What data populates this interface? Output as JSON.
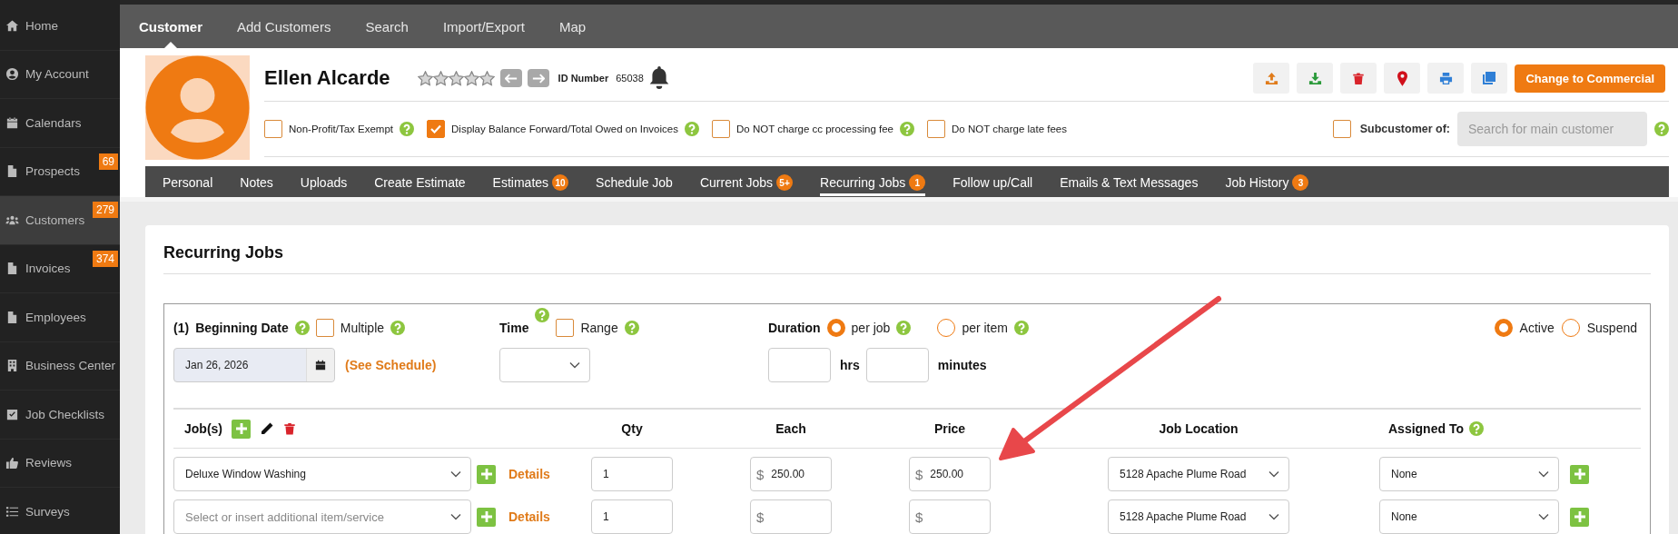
{
  "sidebar": {
    "items": [
      {
        "label": "Home",
        "selected": false
      },
      {
        "label": "My Account",
        "selected": false
      },
      {
        "label": "Calendars",
        "selected": false
      },
      {
        "label": "Prospects",
        "selected": false,
        "badge": "69"
      },
      {
        "label": "Customers",
        "selected": true,
        "badge": "279"
      },
      {
        "label": "Invoices",
        "selected": false,
        "badge": "374"
      },
      {
        "label": "Employees",
        "selected": false
      },
      {
        "label": "Business Center",
        "selected": false
      },
      {
        "label": "Job Checklists",
        "selected": false
      },
      {
        "label": "Reviews",
        "selected": false
      },
      {
        "label": "Surveys",
        "selected": false
      }
    ]
  },
  "top_nav": [
    {
      "label": "Customer",
      "selected": true
    },
    {
      "label": "Add Customers",
      "selected": false
    },
    {
      "label": "Search",
      "selected": false
    },
    {
      "label": "Import/Export",
      "selected": false
    },
    {
      "label": "Map",
      "selected": false
    }
  ],
  "customer": {
    "name": "Ellen Alcarde",
    "stars": 0,
    "id_label": "ID Number",
    "id_value": "65038"
  },
  "primary_button": "Change to Commercial",
  "options": [
    {
      "label": "Non-Profit/Tax Exempt",
      "checked": false,
      "help": true
    },
    {
      "label": "Display Balance Forward/Total Owed on Invoices",
      "checked": true,
      "help": true
    },
    {
      "label": "Do NOT charge cc processing fee",
      "checked": false,
      "help": true
    },
    {
      "label": "Do NOT charge late fees",
      "checked": false,
      "help": false
    }
  ],
  "subcustomer": {
    "label": "Subcustomer of:",
    "checked": false,
    "placeholder": "Search for main customer"
  },
  "tabs": [
    {
      "label": "Personal",
      "selected": false
    },
    {
      "label": "Notes",
      "selected": false
    },
    {
      "label": "Uploads",
      "selected": false
    },
    {
      "label": "Create Estimate",
      "selected": false
    },
    {
      "label": "Estimates",
      "selected": false,
      "badge": "10"
    },
    {
      "label": "Schedule Job",
      "selected": false
    },
    {
      "label": "Current Jobs",
      "selected": false,
      "badge": "5+"
    },
    {
      "label": "Recurring Jobs",
      "selected": true,
      "badge": "1"
    },
    {
      "label": "Follow up/Call",
      "selected": false
    },
    {
      "label": "Emails & Text Messages",
      "selected": false
    },
    {
      "label": "Job History",
      "selected": false,
      "badge": "3"
    }
  ],
  "section_title": "Recurring Jobs",
  "schedule": {
    "index": "(1)",
    "beginning_date_label": "Beginning Date",
    "multiple": {
      "label": "Multiple",
      "checked": false
    },
    "time_label": "Time",
    "range": {
      "label": "Range",
      "checked": false
    },
    "duration_label": "Duration",
    "duration_options": [
      {
        "label": "per job",
        "selected": true
      },
      {
        "label": "per item",
        "selected": false
      }
    ],
    "status_options": [
      {
        "label": "Active",
        "selected": true
      },
      {
        "label": "Suspend",
        "selected": false
      }
    ],
    "date": "Jan 26, 2026",
    "see_schedule": "(See Schedule)",
    "hrs_label": "hrs",
    "minutes_label": "minutes"
  },
  "jobs_table": {
    "columns": [
      "Job(s)",
      "Qty",
      "Each",
      "Price",
      "Job Location",
      "Assigned To"
    ],
    "rows": [
      {
        "job": "Deluxe Window Washing",
        "details": "Details",
        "qty": "1",
        "each_currency": "$",
        "each": "250.00",
        "price_currency": "$",
        "price": "250.00",
        "location": "5128 Apache Plume Road",
        "assigned": "None"
      },
      {
        "job_placeholder": "Select or insert additional item/service",
        "details": "Details",
        "qty": "1",
        "each_currency": "$",
        "price_currency": "$",
        "location": "5128 Apache Plume Road",
        "assigned": "None"
      }
    ]
  }
}
